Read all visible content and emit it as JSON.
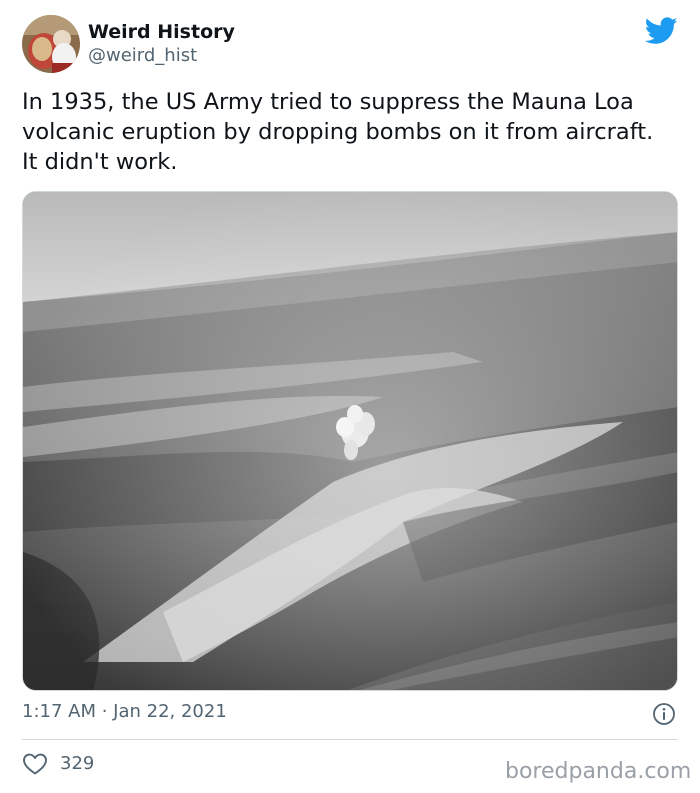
{
  "author": {
    "display_name": "Weird History",
    "handle": "@weird_hist"
  },
  "tweet": {
    "text": "In 1935, the US Army tried to suppress the Mauna Loa volcanic eruption by dropping bombs on it from aircraft. It didn't work.",
    "timestamp": "1:17 AM · Jan 22, 2021",
    "likes": "329"
  },
  "icons": {
    "brand": "twitter-bird-icon",
    "info": "info-icon",
    "like": "heart-icon"
  },
  "colors": {
    "twitter_blue": "#1d9bf0",
    "secondary_text": "#536471",
    "primary_text": "#0f1419"
  },
  "watermark": "boredpanda.com"
}
